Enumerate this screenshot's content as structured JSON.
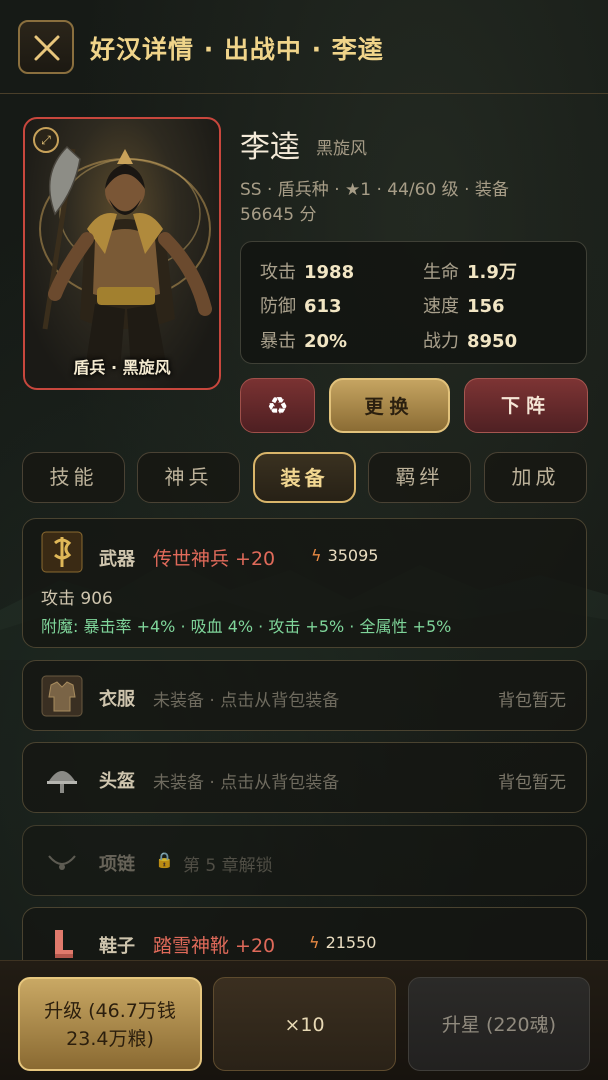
{
  "header": {
    "title": "好汉详情 · 出战中 · 李逵"
  },
  "hero": {
    "name": "李逵",
    "nickname": "黑旋风",
    "meta": "SS · 盾兵种 · ★1 · 44/60 级 · 装备 56645 分",
    "portrait_caption": "盾兵 · 黑旋风",
    "stats": [
      {
        "label": "攻击",
        "value": "1988"
      },
      {
        "label": "生命",
        "value": "1.9万"
      },
      {
        "label": "防御",
        "value": "613"
      },
      {
        "label": "速度",
        "value": "156"
      },
      {
        "label": "暴击",
        "value": "20%"
      },
      {
        "label": "战力",
        "value": "8950"
      }
    ]
  },
  "actions": {
    "swap": "更换",
    "remove": "下阵"
  },
  "tabs": [
    {
      "label": "技能",
      "active": false
    },
    {
      "label": "神兵",
      "active": false
    },
    {
      "label": "装备",
      "active": true
    },
    {
      "label": "羁绊",
      "active": false
    },
    {
      "label": "加成",
      "active": false
    }
  ],
  "equipment": {
    "weapon": {
      "slot": "武器",
      "name": "传世神兵 +20",
      "power": "35095",
      "sub": "攻击 906",
      "enchant": "附魔: 暴击率 +4% · 吸血 4% · 攻击 +5% · 全属性 +5%"
    },
    "armor": {
      "slot": "衣服",
      "note": "未装备 · 点击从背包装备",
      "right": "背包暂无"
    },
    "helmet": {
      "slot": "头盔",
      "note": "未装备 · 点击从背包装备",
      "right": "背包暂无"
    },
    "necklace": {
      "slot": "项链",
      "note": "第 5 章解锁"
    },
    "boots": {
      "slot": "鞋子",
      "name": "踏雪神靴 +20",
      "power": "21550"
    }
  },
  "bottom": {
    "upgrade_line1": "升级 (46.7万钱",
    "upgrade_line2": "23.4万粮)",
    "x10": "×10",
    "star": "升星 (220魂)"
  },
  "colors": {
    "accent_gold": "#f0d48a",
    "rarity_red": "#e06a5a",
    "enchant_green": "#7fd59a",
    "portrait_border": "#c8473d"
  }
}
